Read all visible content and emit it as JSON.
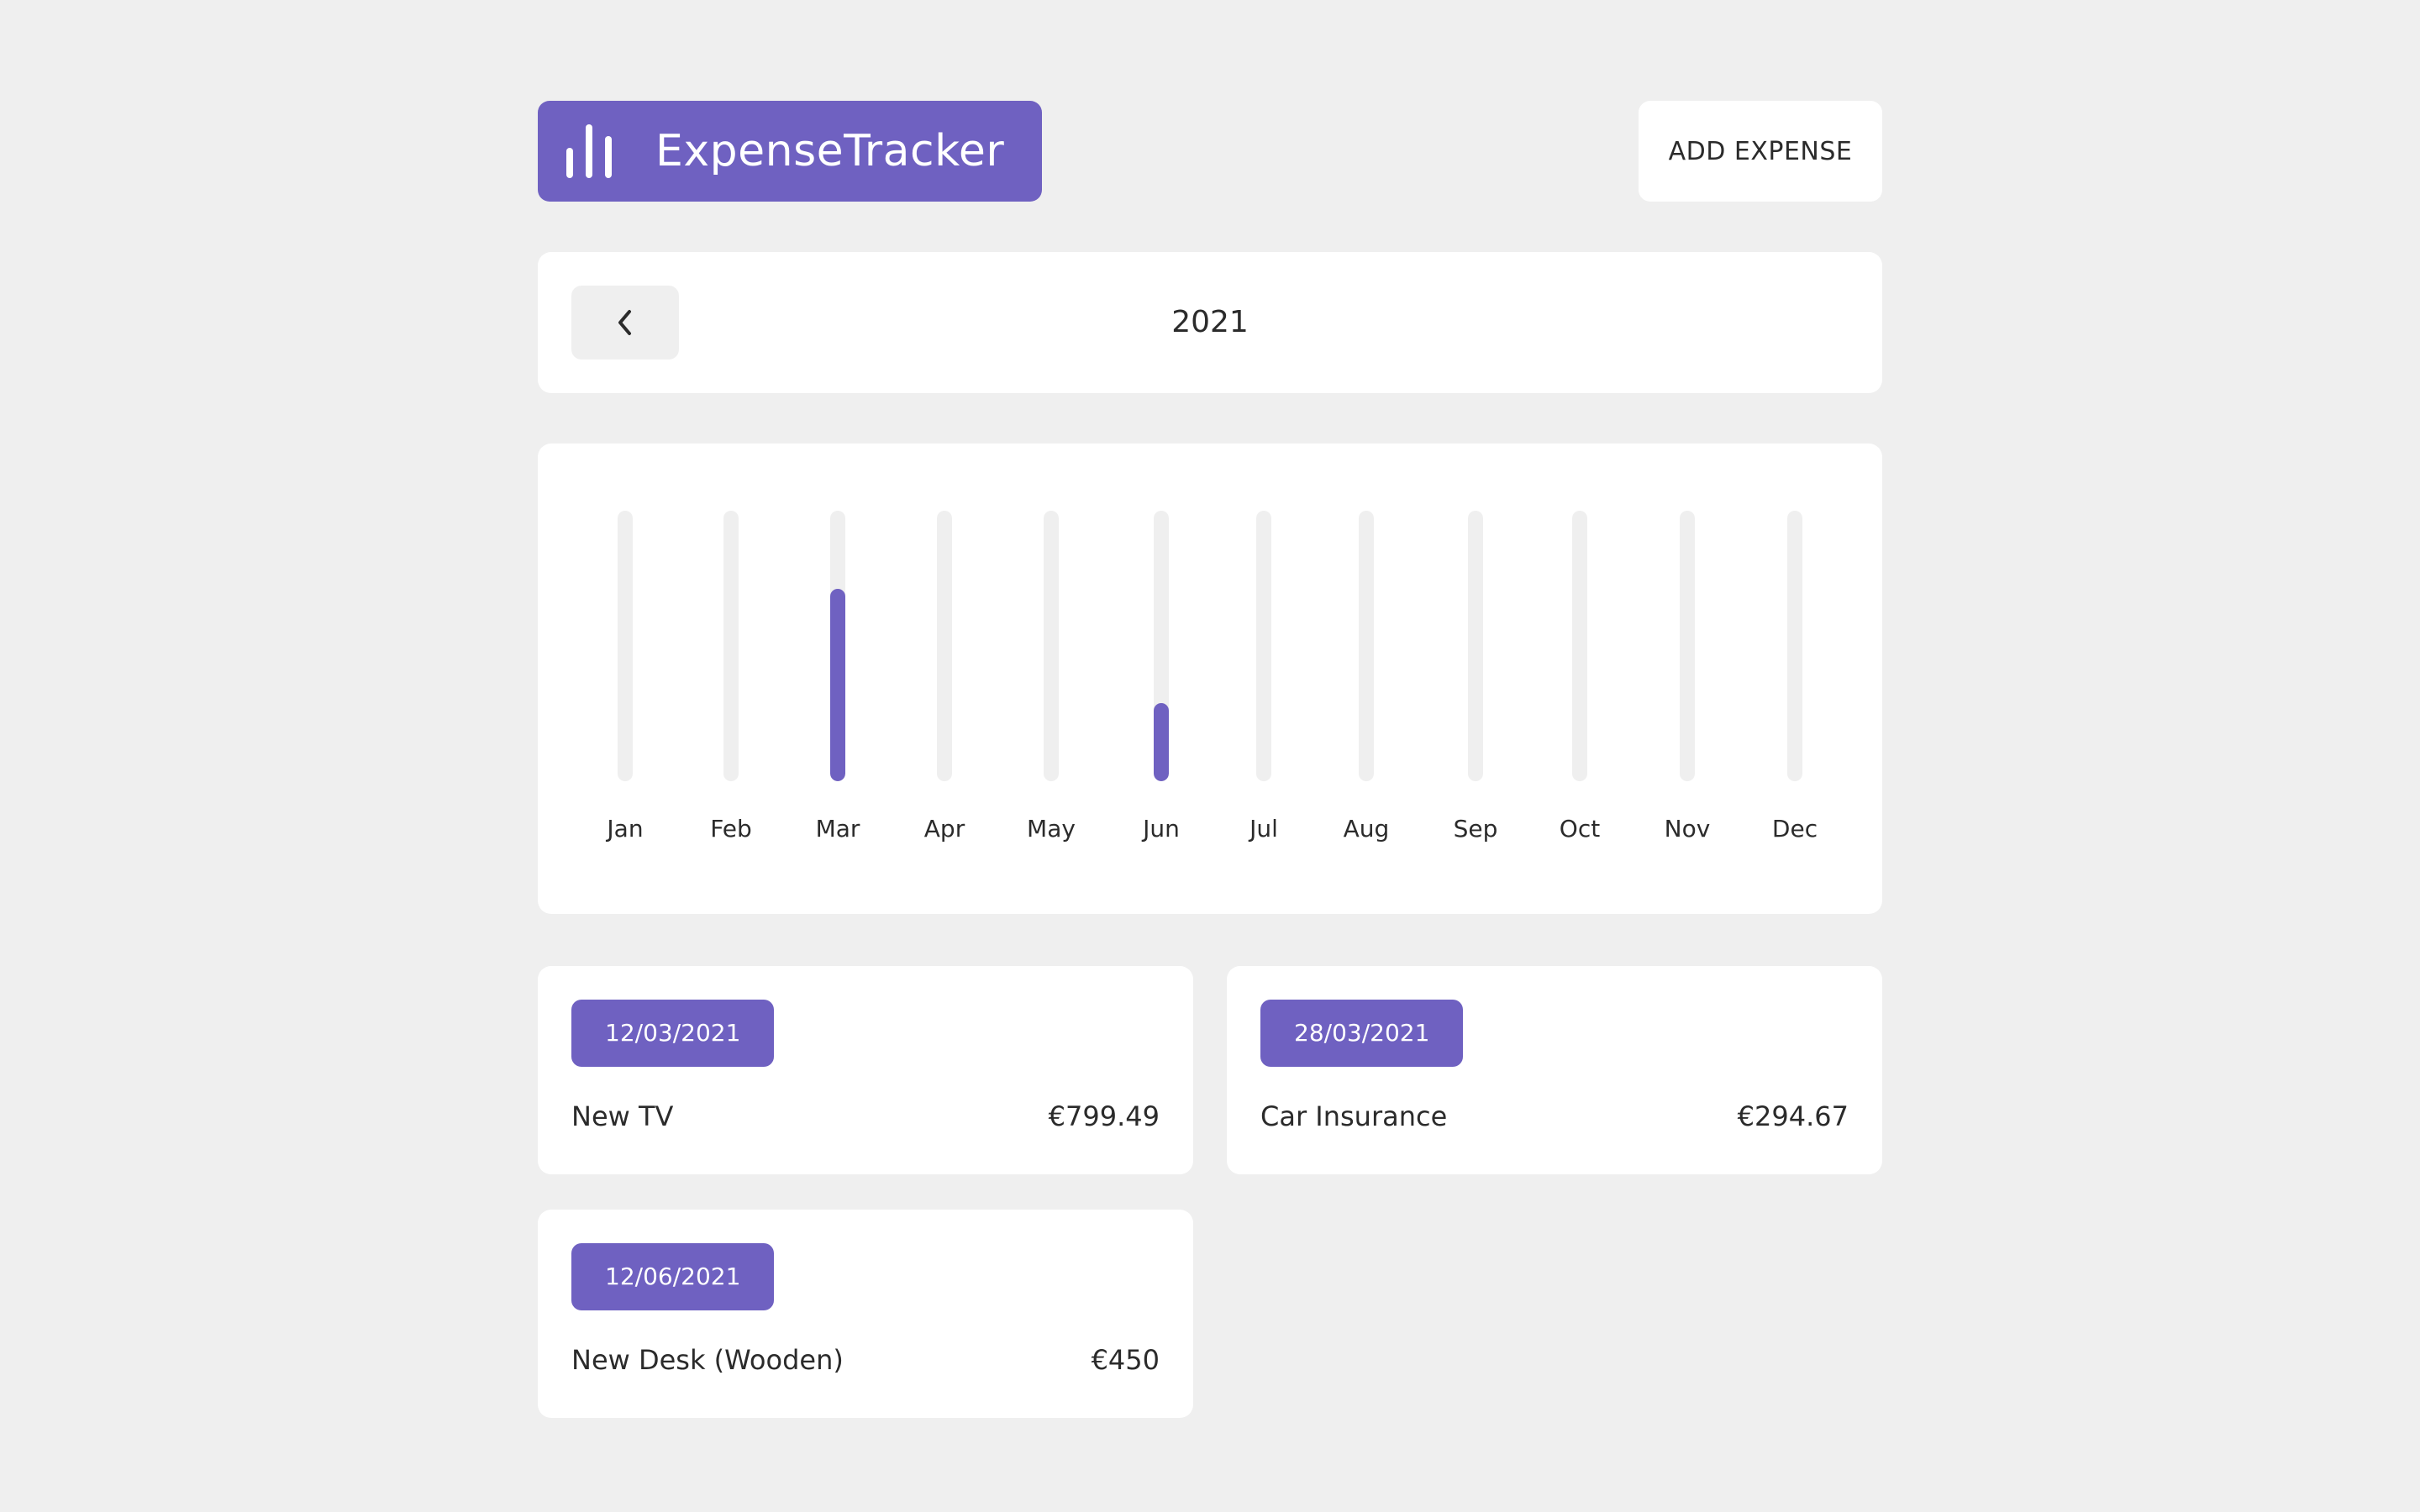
{
  "app": {
    "title": "ExpenseTracker",
    "logo_icon": "bar-chart-icon",
    "accent_color": "#6f61c1",
    "background_color": "#efefef"
  },
  "header": {
    "add_button_label": "ADD EXPENSE"
  },
  "year_selector": {
    "year": "2021",
    "prev_icon": "chevron-left-icon"
  },
  "chart_data": {
    "type": "bar",
    "title": "",
    "categories": [
      "Jan",
      "Feb",
      "Mar",
      "Apr",
      "May",
      "Jun",
      "Jul",
      "Aug",
      "Sep",
      "Oct",
      "Nov",
      "Dec"
    ],
    "values": [
      0,
      0,
      799.49,
      0,
      0,
      450,
      0,
      0,
      0,
      0,
      0,
      0
    ],
    "fill_fraction": [
      0,
      0,
      0.71,
      0,
      0,
      0.29,
      0,
      0,
      0,
      0,
      0,
      0
    ],
    "xlabel": "",
    "ylabel": "",
    "grid": false
  },
  "expenses": [
    {
      "date": "12/03/2021",
      "title": "New TV",
      "amount": "€799.49"
    },
    {
      "date": "28/03/2021",
      "title": "Car Insurance",
      "amount": "€294.67"
    },
    {
      "date": "12/06/2021",
      "title": "New Desk (Wooden)",
      "amount": "€450"
    }
  ]
}
